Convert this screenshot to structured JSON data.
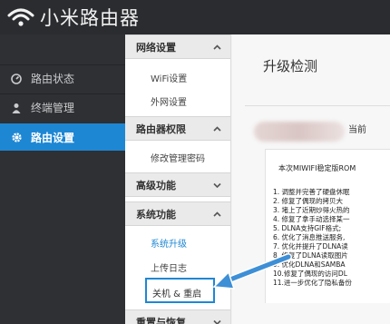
{
  "header": {
    "brand": "小米路由器",
    "logo_icon": "wifi-icon"
  },
  "leftnav": {
    "items": [
      {
        "label": "路由状态",
        "icon": "gauge-icon",
        "active": false
      },
      {
        "label": "终端管理",
        "icon": "user-icon",
        "active": false
      },
      {
        "label": "路由设置",
        "icon": "gear-icon",
        "active": true
      }
    ]
  },
  "submenu": {
    "groups": [
      {
        "label": "网络设置",
        "items": [
          "WiFi设置",
          "外网设置"
        ]
      },
      {
        "label": "路由器权限",
        "items": [
          "修改管理密码"
        ]
      },
      {
        "label": "高级功能",
        "items": []
      },
      {
        "label": "系统功能",
        "items": [
          "系统升级",
          "上传日志",
          "关机 & 重启"
        ],
        "active_item": "系统升级",
        "highlighted_item": "关机 & 重启"
      },
      {
        "label": "重置与恢复",
        "items": []
      }
    ]
  },
  "main": {
    "title": "升级检测",
    "current_label": "当前",
    "notes_head": "本次MIWIFI稳定版ROM",
    "notes": [
      "1. 调整并完善了硬盘休眠",
      "2. 修复了偶现的拷贝大",
      "3. 堵上了近期炒得火热的",
      "4. 修复了拿手动选择某一",
      "5. DLNA支持GIF格式;",
      "6. 优化了消息推送服务,",
      "7. 优化并提升了DLNA读",
      "8. 修复了DLNA读取图片",
      "9. 优化DLNA和SAMBA",
      "10.修复了偶现的访问DL",
      "11.进一步优化了隐私备份"
    ]
  },
  "colors": {
    "accent": "#1e87d4",
    "header_bg": "#2a2c2f",
    "nav_bg": "#2e3033"
  }
}
